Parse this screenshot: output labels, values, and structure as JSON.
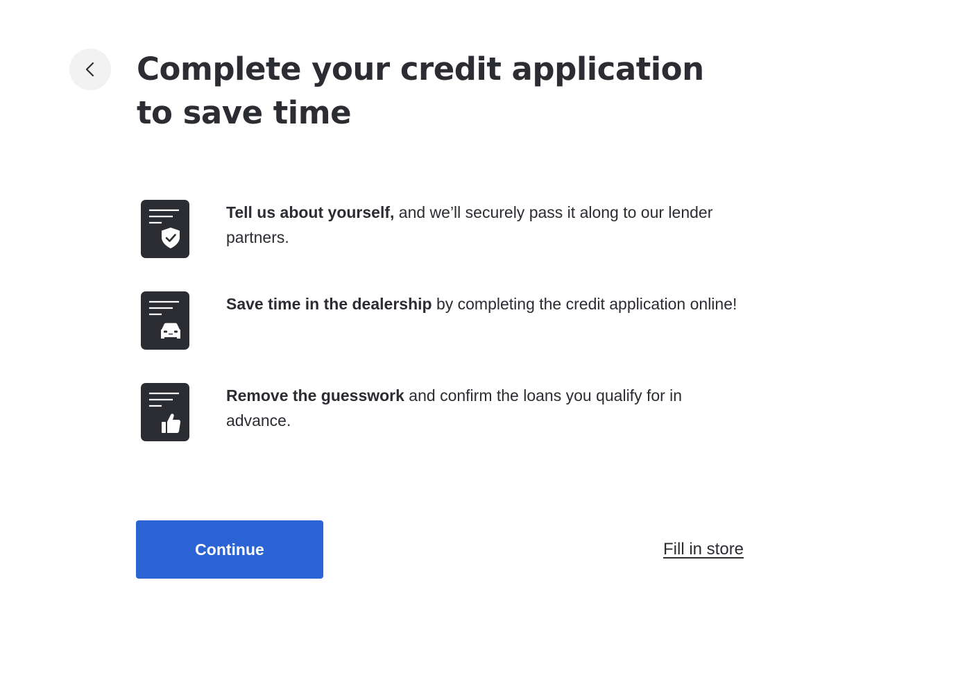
{
  "header": {
    "back_icon": "chevron-left-icon",
    "title": "Complete your credit application to save time"
  },
  "benefits": [
    {
      "icon": "document-shield-icon",
      "bold": "Tell us about yourself,",
      "text": " and we’ll securely pass it along to our lender partners."
    },
    {
      "icon": "document-car-icon",
      "bold": "Save time in the dealership",
      "text": " by completing the credit application online!"
    },
    {
      "icon": "document-thumbs-up-icon",
      "bold": "Remove the guesswork",
      "text": " and confirm the loans you qualify for in advance."
    }
  ],
  "actions": {
    "continue_label": "Continue",
    "fill_in_store_label": "Fill in store"
  },
  "colors": {
    "primary": "#2b63d4",
    "text": "#2b2d33",
    "icon_bg": "#2b2d33",
    "back_bg": "#f2f2f3"
  }
}
